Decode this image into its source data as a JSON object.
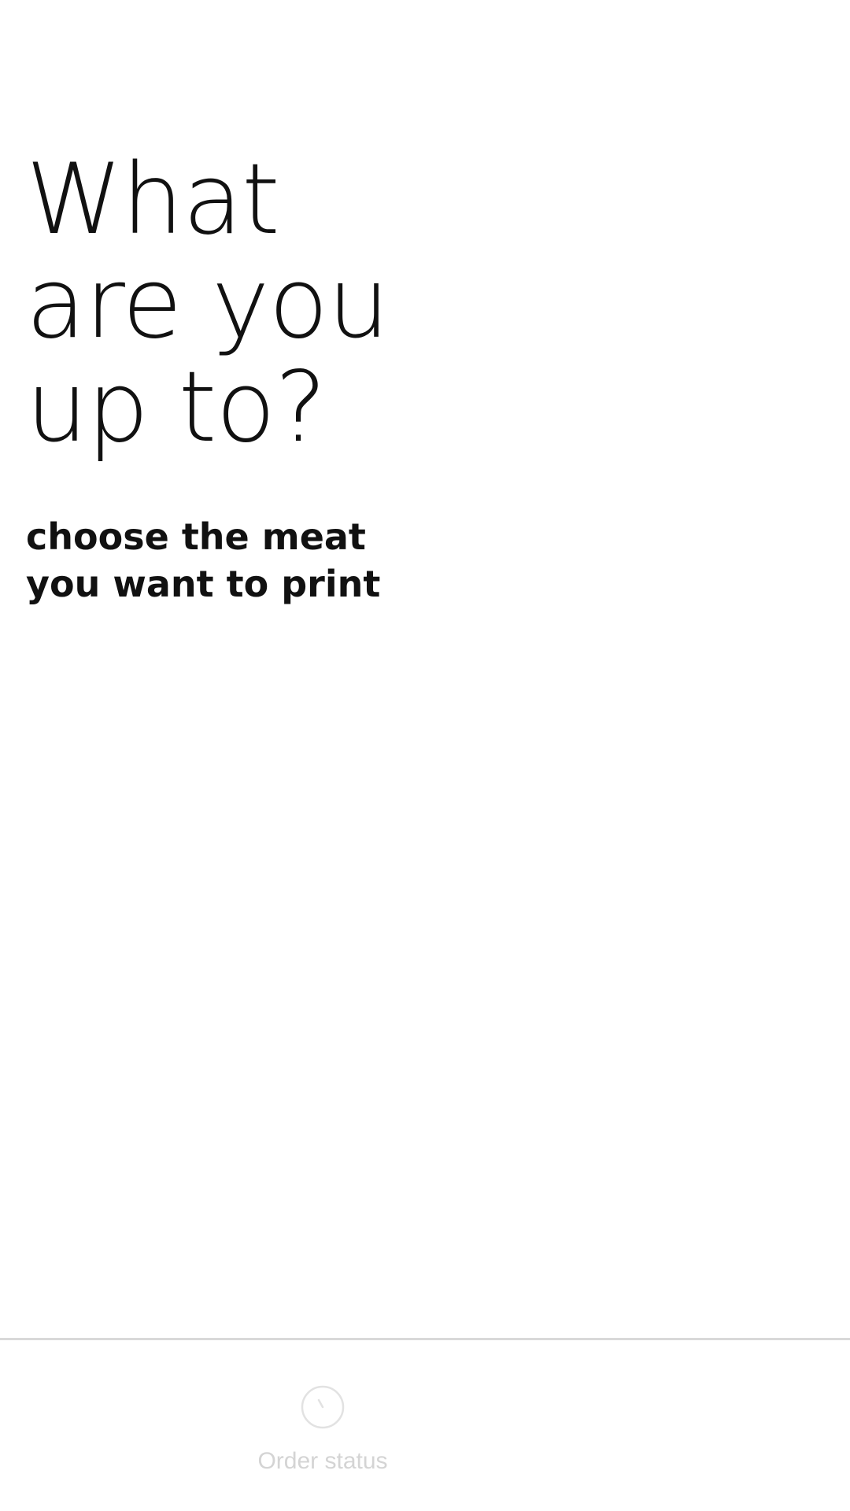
{
  "headline": {
    "line1": "What",
    "line2": "are you",
    "line3": "up to?"
  },
  "subtitle": {
    "line1": "choose the meat",
    "line2": "you want to print"
  },
  "bottom_nav": {
    "items": [
      {
        "label": "Order status",
        "icon": "order-status-icon"
      }
    ],
    "inactive_color": "#d4d4d4"
  }
}
